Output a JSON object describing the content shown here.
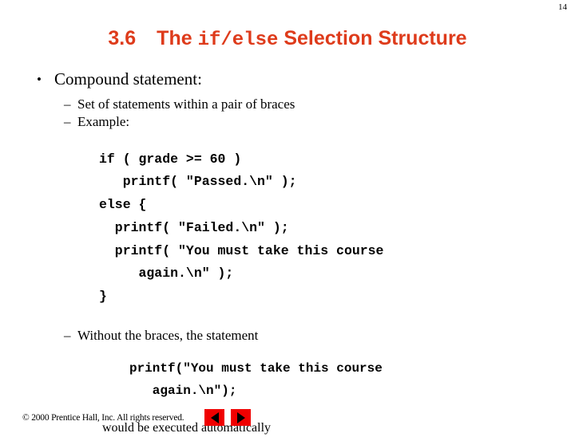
{
  "slide": {
    "page_number": "14",
    "title": {
      "section": "3.6",
      "text_before": "The ",
      "mono": "if/else",
      "text_after": " Selection Structure",
      "color": "#DE3B1B"
    },
    "bullets": [
      {
        "level": 1,
        "marker": "•",
        "text": "Compound statement:"
      },
      {
        "level": 2,
        "marker": "–",
        "text": "Set of statements within a pair of braces"
      },
      {
        "level": 2,
        "marker": "–",
        "text": "Example:"
      }
    ],
    "code_block_1": "if ( grade >= 60 )\n   printf( \"Passed.\\n\" );\nelse {\n  printf( \"Failed.\\n\" );\n  printf( \"You must take this course\n     again.\\n\" );\n}",
    "bullet_without_braces": {
      "marker": "–",
      "text": "Without the braces, the statement"
    },
    "code_block_2": "printf(\"You must take this course\n   again.\\n\");",
    "closing_line": "would be executed automatically"
  },
  "footer": {
    "copyright": "© 2000 Prentice Hall, Inc.  All rights reserved.",
    "nav": {
      "prev_label": "previous-slide",
      "next_label": "next-slide",
      "button_color": "#F00000"
    }
  }
}
